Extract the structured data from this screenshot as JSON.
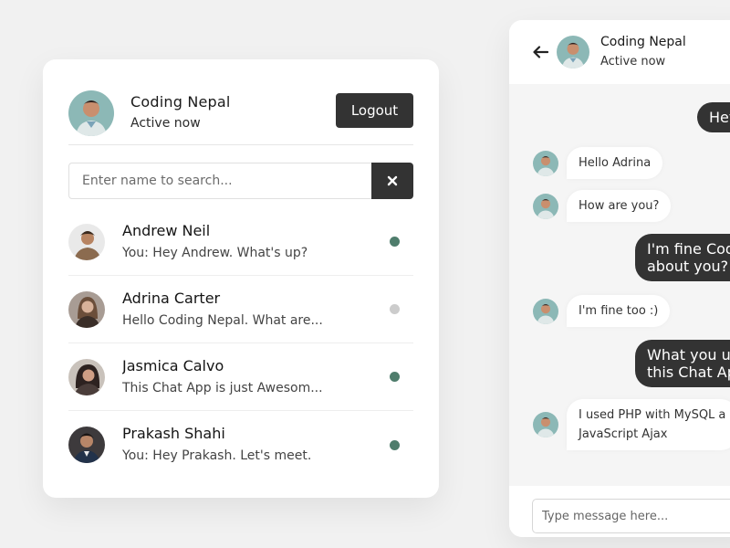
{
  "users_panel": {
    "header": {
      "name": "Coding Nepal",
      "status": "Active now",
      "logout_label": "Logout"
    },
    "search": {
      "placeholder": "Enter name to search...",
      "button_icon": "close-icon"
    },
    "users": [
      {
        "name": "Andrew Neil",
        "message": "You: Hey Andrew. What's up?",
        "online": true
      },
      {
        "name": "Adrina Carter",
        "message": "Hello Coding Nepal. What are...",
        "online": false
      },
      {
        "name": "Jasmica Calvo",
        "message": "This Chat App is just Awesom...",
        "online": true
      },
      {
        "name": "Prakash Shahi",
        "message": "You: Hey Prakash. Let's meet.",
        "online": true
      }
    ]
  },
  "chat_panel": {
    "header": {
      "back_icon": "arrow-left-icon",
      "name": "Coding Nepal",
      "status": "Active now"
    },
    "messages": [
      {
        "type": "outgoing",
        "lines": [
          "Hey"
        ]
      },
      {
        "type": "incoming",
        "lines": [
          "Hello Adrina"
        ]
      },
      {
        "type": "incoming",
        "lines": [
          "How are you?"
        ]
      },
      {
        "type": "outgoing",
        "lines": [
          "I'm fine Codin",
          "about you?"
        ]
      },
      {
        "type": "incoming",
        "lines": [
          "I'm fine too :)"
        ]
      },
      {
        "type": "outgoing",
        "lines": [
          "What you use",
          "this Chat App"
        ]
      },
      {
        "type": "incoming",
        "lines": [
          "I used PHP with MySQL a",
          "JavaScript Ajax"
        ]
      }
    ],
    "input": {
      "placeholder": "Type message here..."
    }
  },
  "colors": {
    "background": "#f1f1f1",
    "dark": "#333333",
    "online_dot": "#4f7d6c",
    "offline_dot": "#cccccc",
    "chat_bg": "#f5f5f5"
  }
}
